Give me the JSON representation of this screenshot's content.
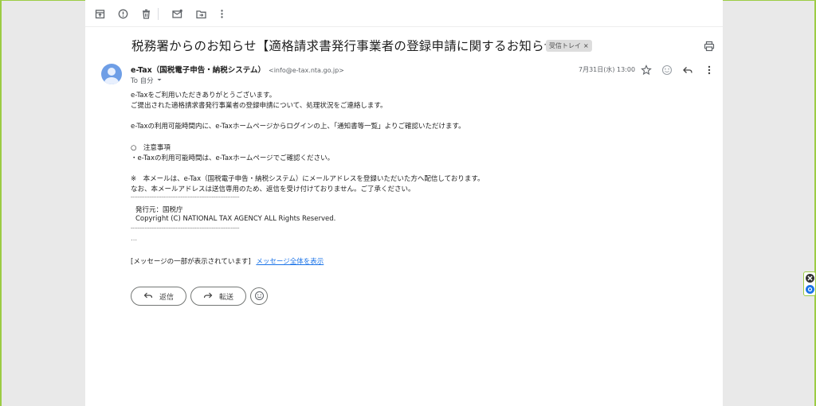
{
  "toolbar": {
    "icons": [
      "archive-icon",
      "report-spam-icon",
      "delete-icon",
      "mark-unread-icon",
      "move-to-icon",
      "more-icon"
    ]
  },
  "message": {
    "subject": "税務署からのお知らせ【適格請求書発行事業者の登録申請に関するお知らせ】",
    "label": "受信トレイ",
    "label_close": "×",
    "sender_name": "e-Tax（国税電子申告・納税システム）",
    "sender_email": "<info@e-tax.nta.go.jp>",
    "to": "To 自分",
    "date": "7月31日(水) 13:00",
    "body": {
      "line1": "e-Taxをご利用いただきありがとうございます。",
      "line2": "ご提出された適格請求書発行事業者の登録申請について、処理状況をご連絡します。",
      "line3": "e-Taxの利用可能時間内に、e-Taxホームページからログインの上、「通知書等一覧」よりご確認いただけます。",
      "line4": "○　注意事項",
      "line5": "・e-Taxの利用可能時間は、e-Taxホームページでご確認ください。",
      "line6": "※　本メールは、e-Tax（国税電子申告・納税システム）にメールアドレスを登録いただいた方へ配信しております。",
      "line7": "なお、本メールアドレスは送信専用のため、返信を受け付けておりません。ご了承ください。",
      "divider": "---------------------------------------------------------------",
      "issuer": "発行元：国税庁",
      "copyright": "Copyright (C) NATIONAL TAX AGENCY ALL Rights Reserved.",
      "ellipsis": "...",
      "clipped": "[メッセージの一部が表示されています]",
      "clipped_link": "メッセージ全体を表示"
    }
  },
  "actions": {
    "reply": "返信",
    "forward": "転送"
  },
  "colors": {
    "accent": "#1a73e8",
    "avatar": "#6e9ee6",
    "frame": "#9ccc44"
  }
}
